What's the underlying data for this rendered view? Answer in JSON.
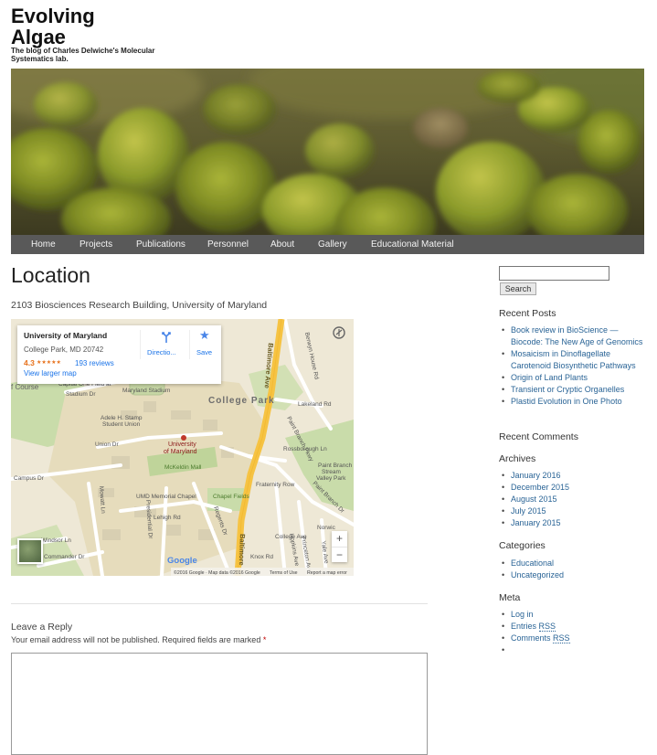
{
  "site": {
    "title": "Evolving Algae",
    "description": "The blog of Charles Delwiche's Molecular Systematics lab."
  },
  "nav": {
    "items": [
      "Home",
      "Projects",
      "Publications",
      "Personnel",
      "About",
      "Gallery",
      "Educational Material"
    ]
  },
  "page": {
    "title": "Location",
    "address": "2103 Biosciences Research Building, University of Maryland"
  },
  "map": {
    "place_name": "University of Maryland",
    "place_address": "College Park, MD 20742",
    "rating": "4.3",
    "stars": "★★★★★",
    "reviews": "193 reviews",
    "directions": "Directio...",
    "save": "Save",
    "larger_map": "View larger map",
    "labels": {
      "college_park": "College Park",
      "umd_1": "University",
      "umd_2": "of Maryland",
      "mckeldin": "McKeldin Mall",
      "stamp": "Adele H. Stamp",
      "stamp2": "Student Union",
      "chapel": "UMD Memorial Chapel",
      "chapel_fields": "Chapel Fields",
      "stadium": "Maryland Stadium",
      "capital_one": "Capital One Field at",
      "paint_branch": "Paint Branch",
      "paint_branch2": "Stream",
      "paint_branch3": "Valley Park",
      "course": "f Course",
      "baltimore_ave": "Baltimore Ave",
      "baltimore_ave2": "Baltimore",
      "campus_dr": "Campus Dr",
      "union_dr": "Union Dr",
      "stadium_dr": "Stadium Dr",
      "windsor": "Windsor Ln",
      "commander": "Commander Dr",
      "mowatt": "Mowatt Ln",
      "presidential": "Presidential Dr",
      "regents": "Regents Dr",
      "lehigh": "Lehigh Rd",
      "rossborough": "Rossborough Ln",
      "fraternity": "Fraternity Row",
      "college_ave": "College Ave",
      "knox": "Knox Rd",
      "lakeland": "Lakeland Rd",
      "berwyn": "Berwyn House Rd",
      "paint_branch_pkwy": "Paint Branch Pkwy",
      "paint_branch_dr": "Paint Branch Dr",
      "norwich": "Norwic",
      "hopkins": "Hopkins Ave",
      "princeton": "Princeton Ave",
      "yale": "Yale Ave",
      "google": "Google",
      "zoom_in": "+",
      "zoom_out": "−",
      "footer": "©2016 Google · Map data ©2016 Google",
      "terms": "Terms of Use",
      "report": "Report a map error"
    }
  },
  "comments": {
    "reply_title": "Leave a Reply",
    "note": "Your email address will not be published. Required fields are marked",
    "required_mark": "*"
  },
  "sidebar": {
    "search_button": "Search",
    "recent_posts_title": "Recent Posts",
    "recent_posts": [
      "Book review in BioScience — Biocode: The New Age of Genomics",
      "Mosaicism in Dinoflagellate Carotenoid Biosynthetic Pathways",
      "Origin of Land Plants",
      "Transient or Cryptic Organelles",
      "Plastid Evolution in One Photo"
    ],
    "recent_comments_title": "Recent Comments",
    "archives_title": "Archives",
    "archives": [
      "January 2016",
      "December 2015",
      "August 2015",
      "July 2015",
      "January 2015"
    ],
    "categories_title": "Categories",
    "categories": [
      "Educational",
      "Uncategorized"
    ],
    "meta_title": "Meta",
    "meta": {
      "login": "Log in",
      "entries": "Entries",
      "comments": "Comments",
      "rss": "RSS"
    }
  },
  "colors": {
    "nav_bg": "#595959",
    "link": "#2a6496",
    "required": "#c00000",
    "map_road_major": "#f6c343",
    "map_campus": "#e9dfc4",
    "rating": "#e7711b"
  }
}
